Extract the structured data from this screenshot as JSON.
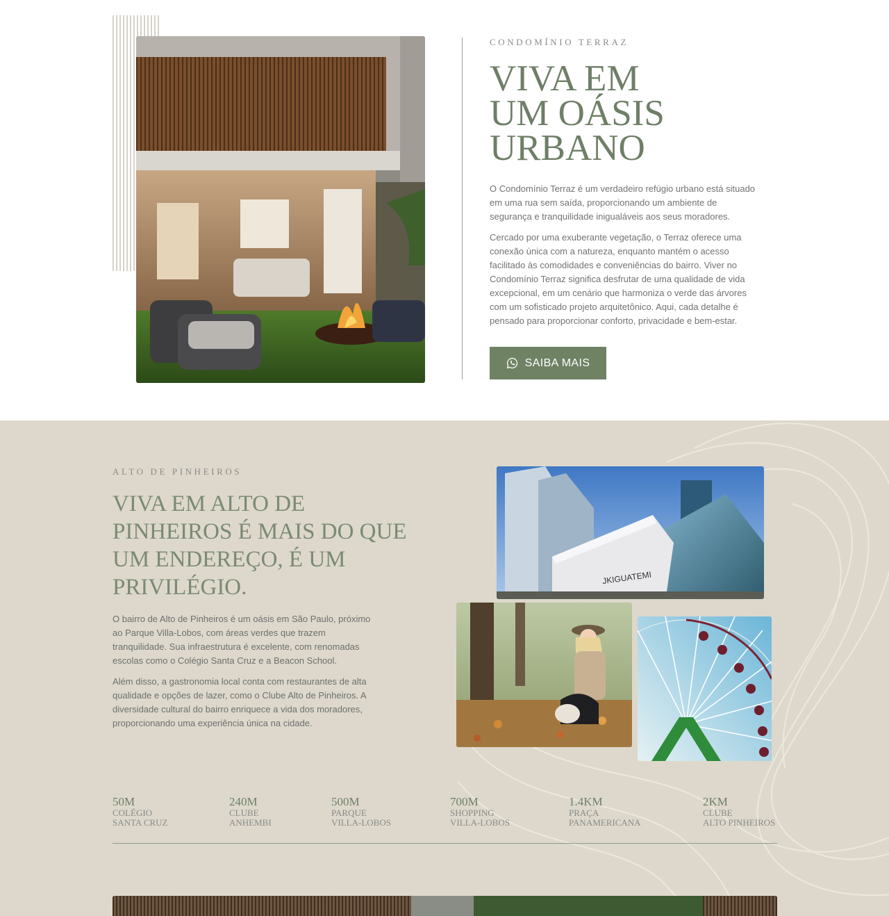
{
  "intro": {
    "eyebrow": "CONDOMÍNIO TERRAZ",
    "title_lines": [
      "VIVA EM",
      "UM OÁSIS",
      "URBANO"
    ],
    "paragraph_1": "O Condomínio Terraz é um verdadeiro refúgio urbano está situado em uma rua sem saída, proporcionando um ambiente de segurança e tranquilidade inigualáveis aos seus moradores.",
    "paragraph_2": "Cercado por uma exuberante vegetação, o Terraz oferece uma conexão única com a natureza, enquanto mantém o acesso facilitado às comodidades e conveniências do bairro. Viver no Condomínio Terraz significa desfrutar de uma qualidade de vida excepcional, em um cenário que harmoniza o verde das árvores com um sofisticado projeto arquitetônico. Aqui, cada detalhe é pensado para proporcionar conforto, privacidade e bem-estar.",
    "cta_label": "SAIBA MAIS",
    "cta_icon": "whatsapp-icon"
  },
  "neighborhood": {
    "eyebrow": "ALTO DE PINHEIROS",
    "title_lines": [
      "VIVA EM ALTO DE",
      "PINHEIROS É MAIS DO QUE",
      "UM ENDEREÇO, É UM",
      "PRIVILÉGIO."
    ],
    "paragraph_1": "O bairro de Alto de Pinheiros é um oásis em São Paulo, próximo ao Parque Villa-Lobos, com áreas verdes que trazem tranquilidade. Sua infraestrutura é excelente, com renomadas escolas como o Colégio Santa Cruz e a Beacon School.",
    "paragraph_2": "Além disso, a gastronomia local conta com restaurantes de alta qualidade e opções de lazer, como o Clube Alto de Pinheiros. A diversidade cultural do bairro enriquece a vida dos moradores, proporcionando uma experiência única na cidade.",
    "mall_sign": "JKIGUATEMI"
  },
  "distances": [
    {
      "value": "50M",
      "line1": "COLÉGIO",
      "line2": "SANTA CRUZ"
    },
    {
      "value": "240M",
      "line1": "CLUBE",
      "line2": "ANHEMBI"
    },
    {
      "value": "500M",
      "line1": "PARQUE",
      "line2": "VILLA-LOBOS"
    },
    {
      "value": "700M",
      "line1": "SHOPPING",
      "line2": "VILLA-LOBOS"
    },
    {
      "value": "1.4KM",
      "line1": "PRAÇA",
      "line2": "PANAMERICANA"
    },
    {
      "value": "2KM",
      "line1": "CLUBE",
      "line2": "ALTO PINHEIROS"
    }
  ],
  "colors": {
    "accent": "#6f8264",
    "title_green": "#6f7f67",
    "beige_bg": "#ddd8cb"
  }
}
